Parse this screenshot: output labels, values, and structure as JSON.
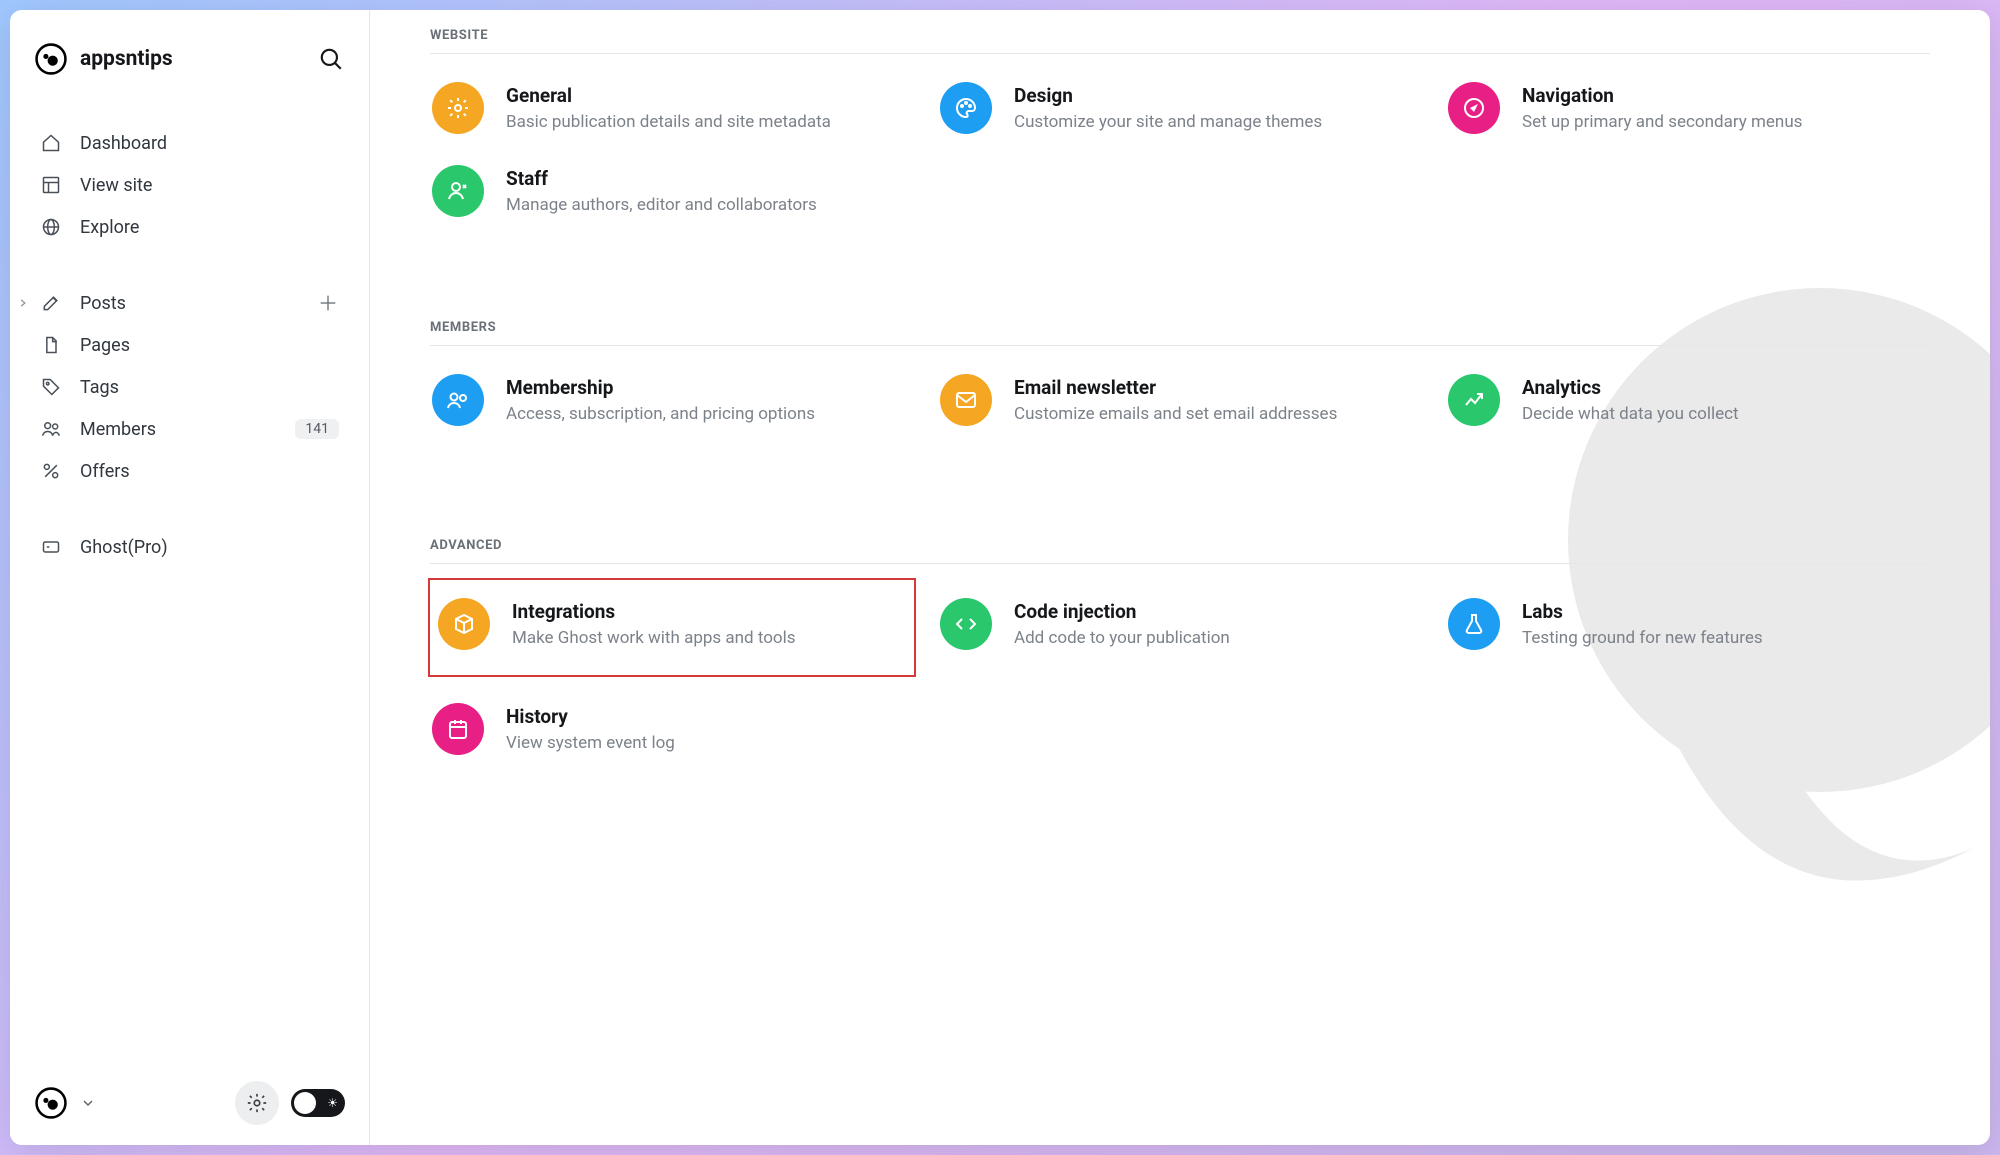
{
  "brand": {
    "name": "appsntips"
  },
  "sidebar": {
    "nav1": [
      {
        "label": "Dashboard"
      },
      {
        "label": "View site"
      },
      {
        "label": "Explore"
      }
    ],
    "nav2": [
      {
        "label": "Posts"
      },
      {
        "label": "Pages"
      },
      {
        "label": "Tags"
      },
      {
        "label": "Members",
        "badge": "141"
      },
      {
        "label": "Offers"
      }
    ],
    "nav3": [
      {
        "label": "Ghost(Pro)"
      }
    ]
  },
  "sections": {
    "website": {
      "label": "WEBSITE",
      "items": [
        {
          "title": "General",
          "desc": "Basic publication details and site metadata",
          "color": "ic-orange",
          "icon": "gear"
        },
        {
          "title": "Design",
          "desc": "Customize your site and manage themes",
          "color": "ic-blue",
          "icon": "palette"
        },
        {
          "title": "Navigation",
          "desc": "Set up primary and secondary menus",
          "color": "ic-pink",
          "icon": "nav-arrow"
        },
        {
          "title": "Staff",
          "desc": "Manage authors, editor and collaborators",
          "color": "ic-green",
          "icon": "staff"
        }
      ]
    },
    "members": {
      "label": "MEMBERS",
      "items": [
        {
          "title": "Membership",
          "desc": "Access, subscription, and pricing options",
          "color": "ic-blue",
          "icon": "members"
        },
        {
          "title": "Email newsletter",
          "desc": "Customize emails and set email addresses",
          "color": "ic-orange",
          "icon": "mail"
        },
        {
          "title": "Analytics",
          "desc": "Decide what data you collect",
          "color": "ic-green",
          "icon": "chart"
        }
      ]
    },
    "advanced": {
      "label": "ADVANCED",
      "items": [
        {
          "title": "Integrations",
          "desc": "Make Ghost work with apps and tools",
          "color": "ic-orange",
          "icon": "box",
          "highlighted": true
        },
        {
          "title": "Code injection",
          "desc": "Add code to your publication",
          "color": "ic-green",
          "icon": "code"
        },
        {
          "title": "Labs",
          "desc": "Testing ground for new features",
          "color": "ic-blue",
          "icon": "flask"
        },
        {
          "title": "History",
          "desc": "View system event log",
          "color": "ic-pink",
          "icon": "history"
        }
      ]
    }
  }
}
